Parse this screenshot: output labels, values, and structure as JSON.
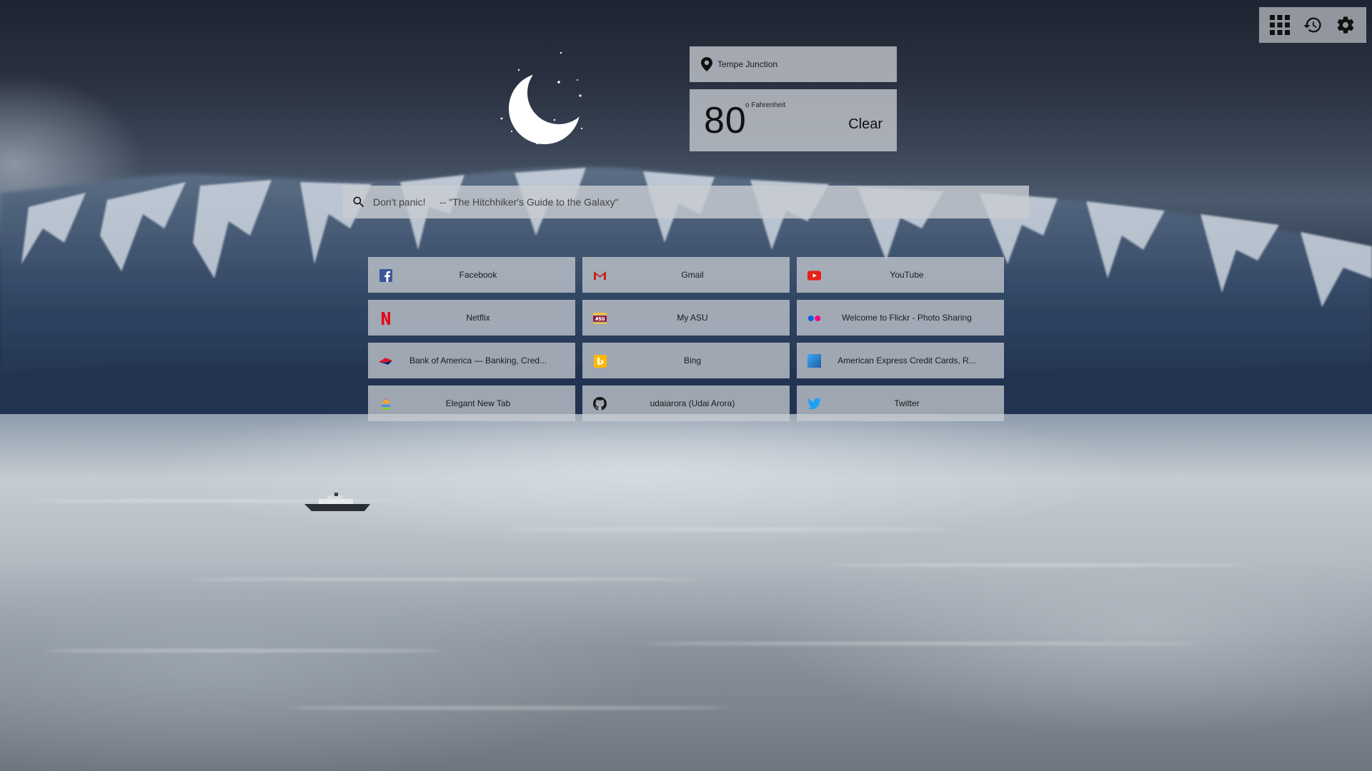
{
  "toolbar": {
    "buttons": [
      {
        "name": "apps-grid-icon"
      },
      {
        "name": "history-icon"
      },
      {
        "name": "settings-gear-icon"
      }
    ]
  },
  "weather": {
    "location": "Tempe Junction",
    "temperature": "80",
    "unit": "o Fahrenheit",
    "condition": "Clear",
    "icon": "moon-night-icon"
  },
  "search": {
    "placeholder": "Don't panic!     -- \"The Hitchhiker's Guide to the Galaxy\"",
    "value": ""
  },
  "tiles": [
    {
      "label": "Facebook",
      "icon": "facebook-icon",
      "color": "#3b5998"
    },
    {
      "label": "Gmail",
      "icon": "gmail-icon",
      "color": "#c5221f"
    },
    {
      "label": "YouTube",
      "icon": "youtube-icon",
      "color": "#e62117"
    },
    {
      "label": "Netflix",
      "icon": "netflix-icon",
      "color": "#e50914"
    },
    {
      "label": "My ASU",
      "icon": "asu-icon",
      "color": "#8c1d40"
    },
    {
      "label": "Welcome to Flickr - Photo Sharing",
      "icon": "flickr-icon",
      "color": "#ff0084"
    },
    {
      "label": "Bank of America — Banking, Cred...",
      "icon": "bank-of-america-icon",
      "color": "#dc1431"
    },
    {
      "label": "Bing",
      "icon": "bing-icon",
      "color": "#ffb900"
    },
    {
      "label": "American Express Credit Cards, R...",
      "icon": "amex-icon",
      "color": "#2e77bc"
    },
    {
      "label": "Elegant New Tab",
      "icon": "elegant-new-tab-icon",
      "color": "#e94e3c"
    },
    {
      "label": "udaiarora (Udai Arora)",
      "icon": "github-icon",
      "color": "#181717"
    },
    {
      "label": "Twitter",
      "icon": "twitter-icon",
      "color": "#1da1f2"
    }
  ]
}
